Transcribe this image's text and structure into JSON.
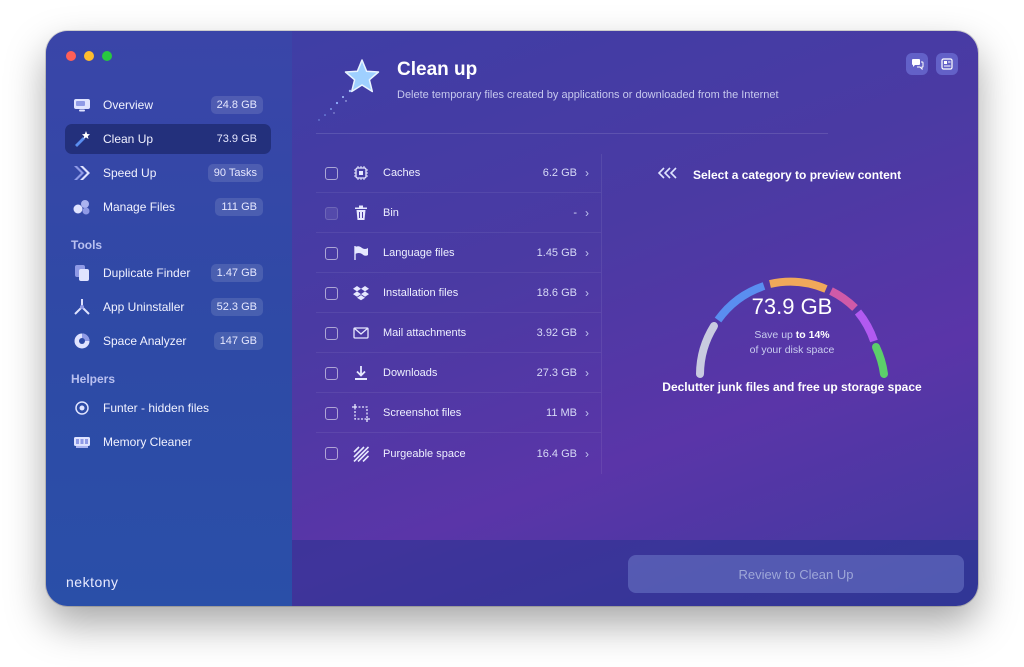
{
  "sidebar": {
    "items": [
      {
        "label": "Overview",
        "badge": "24.8 GB",
        "icon": "monitor-icon"
      },
      {
        "label": "Clean Up",
        "badge": "73.9 GB",
        "icon": "clean-up-icon"
      },
      {
        "label": "Speed Up",
        "badge": "90 Tasks",
        "icon": "speed-up-icon"
      },
      {
        "label": "Manage Files",
        "badge": "111 GB",
        "icon": "manage-files-icon"
      }
    ],
    "tools_title": "Tools",
    "tools": [
      {
        "label": "Duplicate Finder",
        "badge": "1.47 GB",
        "icon": "duplicate-icon"
      },
      {
        "label": "App Uninstaller",
        "badge": "52.3 GB",
        "icon": "uninstaller-icon"
      },
      {
        "label": "Space Analyzer",
        "badge": "147 GB",
        "icon": "pie-chart-icon"
      }
    ],
    "helpers_title": "Helpers",
    "helpers": [
      {
        "label": "Funter - hidden files",
        "icon": "eye-icon"
      },
      {
        "label": "Memory Cleaner",
        "icon": "memory-icon"
      }
    ],
    "brand": "nektony"
  },
  "header": {
    "title": "Clean up",
    "subtitle": "Delete temporary files created by applications or downloaded from the Internet"
  },
  "categories": [
    {
      "label": "Caches",
      "size": "6.2 GB",
      "icon": "chip-icon"
    },
    {
      "label": "Bin",
      "size": "-",
      "icon": "trash-icon"
    },
    {
      "label": "Language files",
      "size": "1.45 GB",
      "icon": "flag-icon"
    },
    {
      "label": "Installation files",
      "size": "18.6 GB",
      "icon": "dropbox-icon"
    },
    {
      "label": "Mail attachments",
      "size": "3.92 GB",
      "icon": "mail-icon"
    },
    {
      "label": "Downloads",
      "size": "27.3 GB",
      "icon": "download-icon"
    },
    {
      "label": "Screenshot files",
      "size": "11 MB",
      "icon": "screenshot-icon"
    },
    {
      "label": "Purgeable space",
      "size": "16.4 GB",
      "icon": "purgeable-icon"
    }
  ],
  "preview": {
    "hint": "Select a category to preview content",
    "total": "73.9 GB",
    "save_prefix": "Save up",
    "save_value": "to 14%",
    "save_suffix": "of your disk space",
    "tagline": "Declutter junk files and free up storage space"
  },
  "footer": {
    "review_label": "Review to Clean Up"
  },
  "colors": {
    "accent": "#5b6bea",
    "gauge": [
      "#c9cbe0",
      "#5a8ef0",
      "#f0a85a",
      "#d05aa8",
      "#b25af0",
      "#5ccf6a"
    ]
  }
}
